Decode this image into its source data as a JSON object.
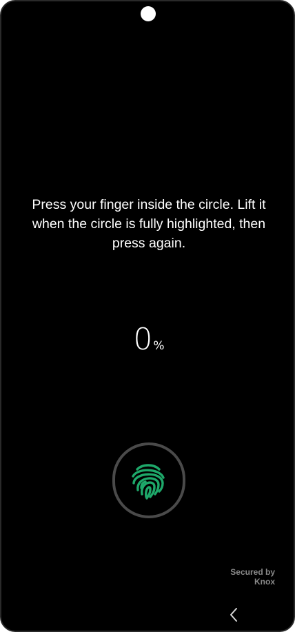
{
  "instruction_text": "Press your finger inside the circle. Lift it when the circle is fully highlighted, then press again.",
  "progress": {
    "value": "0",
    "unit": "%"
  },
  "footer": {
    "secured_by_line1": "Secured by",
    "secured_by_line2": "Knox"
  },
  "colors": {
    "background": "#000000",
    "text": "#ffffff",
    "fingerprint_accent": "#1ea86a",
    "sensor_ring": "#4a4a4a",
    "knox_text": "#8a8a8a"
  },
  "icons": {
    "fingerprint": "fingerprint-icon",
    "back": "chevron-left-icon",
    "camera": "front-camera-cutout"
  }
}
